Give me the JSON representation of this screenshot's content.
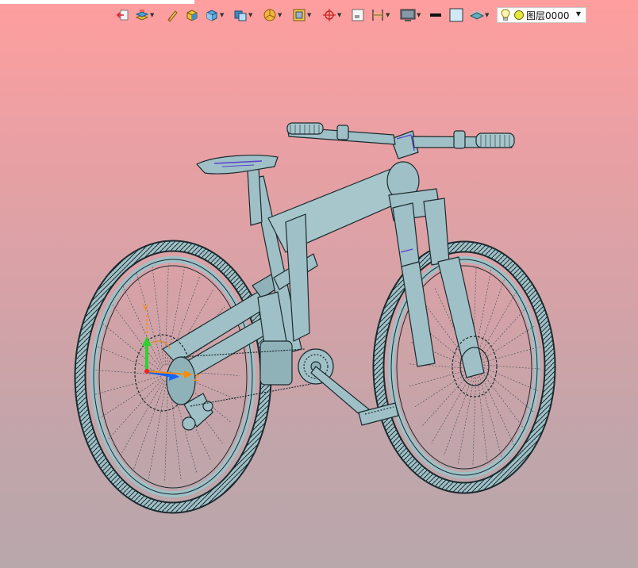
{
  "window": {
    "title_fragment": "",
    "colors": {
      "background_top": "#ff9e9e",
      "background_bottom": "#b8a7ab",
      "model": "#9fc0c6",
      "model_edge": "#1b2a2e",
      "axis_x": "#1565ff",
      "axis_y": "#2fd02f",
      "axis_z": "#ff8a00"
    }
  },
  "toolbar": {
    "icons": [
      "exit-view-icon",
      "layer-stack-icon",
      "pen-icon",
      "box-solid-icon",
      "cube-blue-icon",
      "shaded-cube-icon",
      "pie-section-icon",
      "frame-icon",
      "snap-target-icon",
      "window-icon",
      "dimension-icon",
      "display-mode-icon",
      "line-color-swatch",
      "fill-color-swatch",
      "surface-layer-icon",
      "lightbulb-icon",
      "layer-color-dot"
    ],
    "layer_label": "图层0000"
  },
  "viewport": {
    "model_name": "bicycle-model",
    "triad": {
      "x_label": "",
      "y_label": "Y",
      "z_label": "Z"
    }
  }
}
